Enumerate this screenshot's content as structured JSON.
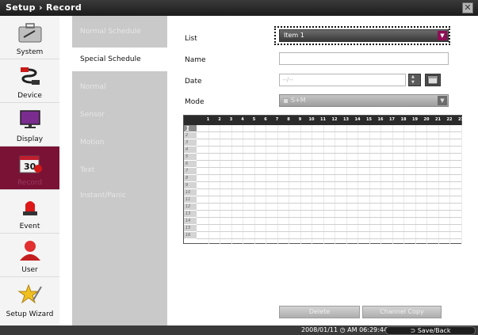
{
  "window": {
    "title": "Setup › Record",
    "close_icon": "close-x-icon"
  },
  "nav": {
    "items": [
      {
        "label": "System",
        "icon": "toolbox-icon"
      },
      {
        "label": "Device",
        "icon": "cable-plug-icon"
      },
      {
        "label": "Display",
        "icon": "monitor-icon"
      },
      {
        "label": "Record",
        "icon": "calendar-record-icon",
        "active": true,
        "badge": "30"
      },
      {
        "label": "Event",
        "icon": "siren-icon"
      },
      {
        "label": "User",
        "icon": "user-icon"
      },
      {
        "label": "Setup Wizard",
        "icon": "wizard-star-icon"
      }
    ]
  },
  "subnav": {
    "items": [
      {
        "label": "Normal Schedule"
      },
      {
        "label": "Special Schedule",
        "active": true
      },
      {
        "label": "Normal"
      },
      {
        "label": "Sensor"
      },
      {
        "label": "Motion"
      },
      {
        "label": "Text"
      },
      {
        "label": "Instant/Panic"
      }
    ]
  },
  "form": {
    "list_label": "List",
    "list_value": "Item 1",
    "name_label": "Name",
    "name_value": "",
    "date_label": "Date",
    "date_value": "--/--",
    "mode_label": "Mode",
    "mode_value": "S+M"
  },
  "schedule_grid": {
    "hours": [
      "1",
      "2",
      "3",
      "4",
      "5",
      "6",
      "7",
      "8",
      "9",
      "10",
      "11",
      "12",
      "13",
      "14",
      "15",
      "16",
      "17",
      "18",
      "19",
      "20",
      "21",
      "22",
      "23"
    ],
    "days": [
      "1",
      "2",
      "3",
      "4",
      "5",
      "6",
      "7",
      "8",
      "9",
      "10",
      "11",
      "12",
      "13",
      "14",
      "15",
      "16"
    ]
  },
  "buttons": {
    "delete": "Delete",
    "channel_copy": "Channel Copy"
  },
  "status": {
    "datetime": "2008/01/11 ◷ AM 06:29:44",
    "save_back": "⊃ Save/Back"
  },
  "colors": {
    "accent": "#7a1236",
    "select_arrow": "#8e0e55",
    "title_bar": "#2a2a2a"
  }
}
